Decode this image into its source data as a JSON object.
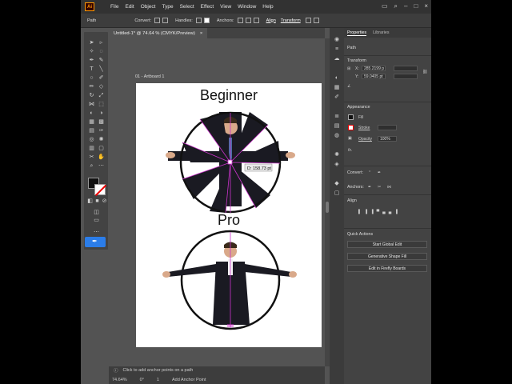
{
  "app": {
    "logo": "Ai"
  },
  "menu": [
    "File",
    "Edit",
    "Object",
    "Type",
    "Select",
    "Effect",
    "View",
    "Window",
    "Help"
  ],
  "control_bar": {
    "selection_type": "Path",
    "convert_label": "Convert:",
    "handles_label": "Handles:",
    "anchors_label": "Anchors:",
    "align_link": "Align",
    "transform_link": "Transform"
  },
  "document_tab": {
    "title": "Untitled-1* @ 74.64 % (CMYK/Preview)",
    "close": "×"
  },
  "artboard": {
    "label": "01 - Artboard 1",
    "top_title": "Beginner",
    "bottom_title": "Pro",
    "distance_tip": "D: 158.73 pt"
  },
  "status": {
    "tip": "Click to add anchor points on a path",
    "zoom": "74.64%",
    "rotation": "0°",
    "artboard_num": "1",
    "tool": "Add Anchor Point"
  },
  "properties": {
    "tabs": [
      "Properties",
      "Libraries"
    ],
    "object_type": "Path",
    "transform_title": "Transform",
    "x_label": "X:",
    "x_value": "285.2199 p",
    "y_label": "Y:",
    "y_value": "59.0405 pt",
    "appearance_title": "Appearance",
    "fill_label": "Fill",
    "stroke_label": "Stroke",
    "opacity_label": "Opacity",
    "opacity_value": "100%",
    "fx_label": "fx.",
    "convert_title": "Convert:",
    "anchors_title": "Anchors:",
    "align_title": "Align",
    "quick_actions_title": "Quick Actions",
    "btn_global_edit": "Start Global Edit",
    "btn_generative": "Generative Shape Fill",
    "btn_firefly": "Edit in Firefly Boards"
  },
  "colors": {
    "accent": "#2b7de9",
    "logo": "#ff9a00",
    "selection": "#cc33cc"
  }
}
